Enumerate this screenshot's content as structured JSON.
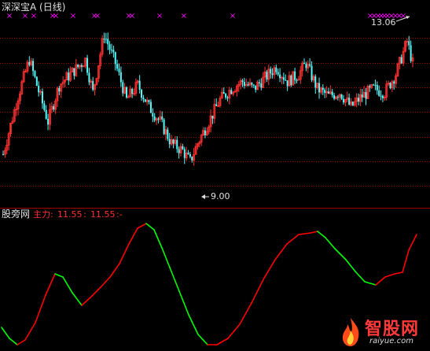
{
  "window": {
    "title": "深深宝A (日线)"
  },
  "main_panel": {
    "price_high_label": "13.06",
    "price_low_label": "9.00",
    "up_color": "#ff3232",
    "down_color": "#54fcfc",
    "marker_color": "#ff00ff",
    "gridline_color": "#a00000"
  },
  "indicator_panel": {
    "name": "股旁网",
    "series_name": "主力:",
    "value_1": "11.55",
    "value_2": "11.55",
    "trailing": ":-",
    "rising_color": "#ff0000",
    "falling_color": "#00ff00"
  },
  "watermark": {
    "brand": "智股网",
    "url": "raiyue.com"
  },
  "chart_data": [
    {
      "type": "candlestick",
      "title": "深深宝A (日线)",
      "annotations": [
        {
          "text": "13.06",
          "meaning": "period high"
        },
        {
          "text": "9.00",
          "meaning": "period low"
        }
      ],
      "close_approx": [
        9.4,
        9.9,
        10.3,
        10.6,
        10.9,
        11.3,
        11.6,
        11.2,
        11.4,
        11.8,
        11.7,
        11.3,
        11.0,
        10.4,
        10.2,
        10.6,
        10.9,
        11.1,
        11.5,
        11.9,
        12.1,
        12.4,
        12.0,
        11.8,
        11.5,
        11.3,
        11.0,
        10.6,
        10.3,
        10.1,
        9.9,
        9.5,
        9.1,
        9.3,
        9.7,
        10.0,
        10.3,
        10.6,
        10.8,
        11.0,
        11.3,
        11.2,
        11.4,
        11.6,
        11.8,
        11.7,
        11.5,
        11.6,
        11.8,
        11.4,
        11.1,
        11.0,
        10.9,
        10.7,
        10.5,
        10.8,
        11.1,
        11.0,
        11.3,
        11.1,
        11.5,
        12.2,
        12.6,
        11.9
      ],
      "markers": "magenta x symbols along top of price panel"
    },
    {
      "type": "line",
      "series": [
        {
          "name": "主力",
          "last_value": 11.55
        }
      ],
      "coloring": "red when rising, green when falling"
    }
  ]
}
